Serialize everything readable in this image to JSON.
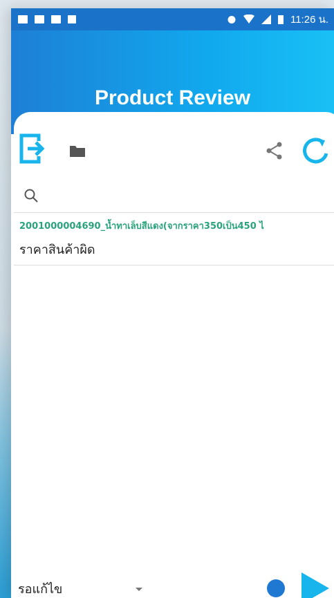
{
  "status_bar": {
    "time": "11:26 น.",
    "icons": [
      "sim-icon",
      "sd-card-icon",
      "photo-icon",
      "mail-icon",
      "alarm-icon",
      "wifi-icon",
      "signal-icon",
      "battery-icon"
    ]
  },
  "header": {
    "title": "Product Review",
    "colors": {
      "gradient_start": "#1d7fd6",
      "gradient_end": "#19c0f5"
    }
  },
  "toolbar": {
    "icons": [
      "logout-icon",
      "folder-icon",
      "share-icon",
      "refresh-icon"
    ],
    "accent": "#18b5ec"
  },
  "search": {
    "placeholder": "",
    "value": ""
  },
  "list": {
    "items": [
      {
        "code": "2001000004690_น้ำทาเล็บสีแดง(จากราคา350เป็น450 ไ",
        "note": "ราคาสินค้าผิด"
      }
    ]
  },
  "footer": {
    "status_selected": "รอแก้ไข",
    "indicator_color": "#1f78d1",
    "play_color": "#18b5ec"
  }
}
